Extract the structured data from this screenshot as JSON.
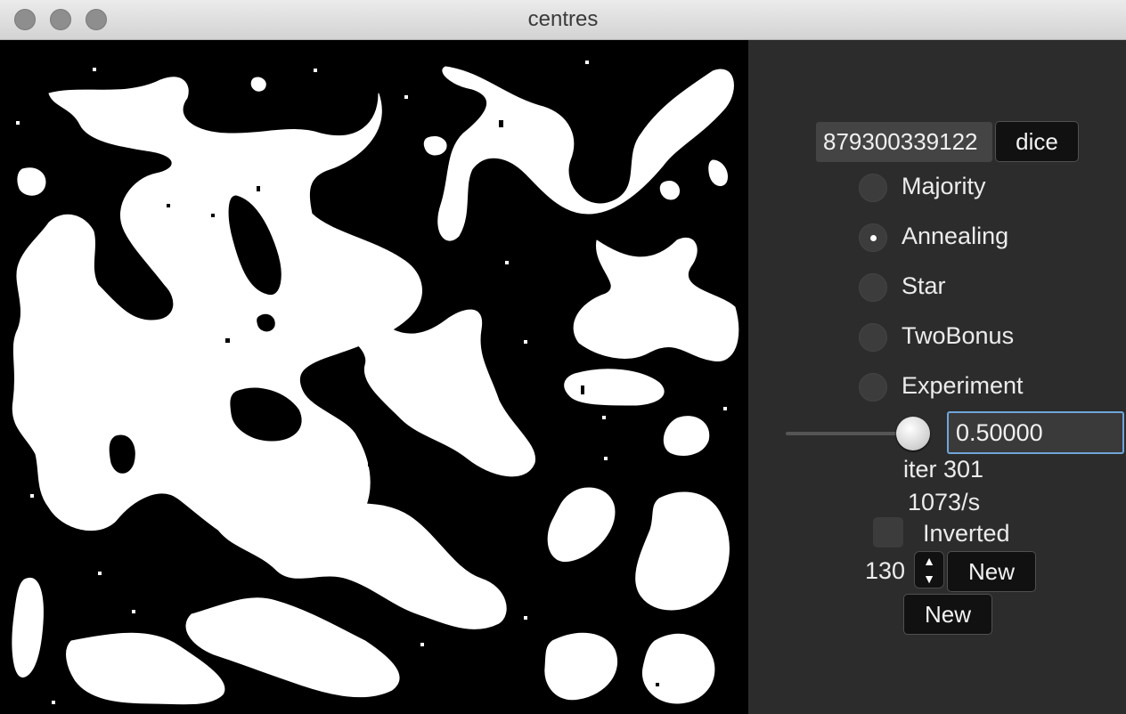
{
  "window": {
    "title": "centres"
  },
  "controls": {
    "seed_value": "879300339122",
    "dice_label": "dice",
    "modes": [
      {
        "label": "Majority",
        "selected": false
      },
      {
        "label": "Annealing",
        "selected": true
      },
      {
        "label": "Star",
        "selected": false
      },
      {
        "label": "TwoBonus",
        "selected": false
      },
      {
        "label": "Experiment",
        "selected": false
      }
    ],
    "slider_value": 0.5,
    "slider_text": "0.50000",
    "iter_text": "iter 301",
    "rate_text": "1073/s",
    "inverted_label": "Inverted",
    "inverted_checked": false,
    "size_value": "130",
    "new_label_1": "New",
    "new_label_2": "New"
  },
  "colors": {
    "foreground": "#ffffff",
    "background": "#000000",
    "focus": "#6fa6d8"
  },
  "icons": {
    "stepper": "up-down-arrows-icon",
    "radio": "radio-button-icon",
    "checkbox": "checkbox-icon"
  }
}
